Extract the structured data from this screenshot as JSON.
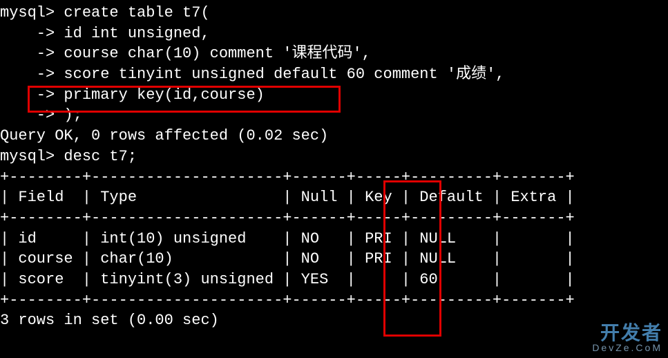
{
  "terminal": {
    "lines": [
      "mysql> create table t7(",
      "    -> id int unsigned,",
      "    -> course char(10) comment '课程代码',",
      "    -> score tinyint unsigned default 60 comment '成绩',",
      "    -> primary key(id,course)",
      "    -> );",
      "Query OK, 0 rows affected (0.02 sec)",
      "mysql> desc t7;",
      "+--------+---------------------+------+-----+---------+-------+",
      "| Field  | Type                | Null | Key | Default | Extra |",
      "+--------+---------------------+------+-----+---------+-------+",
      "| id     | int(10) unsigned    | NO   | PRI | NULL    |       |",
      "| course | char(10)            | NO   | PRI | NULL    |       |",
      "| score  | tinyint(3) unsigned | YES  |     | 60      |       |",
      "+--------+---------------------+------+-----+---------+-------+",
      "3 rows in set (0.00 sec)"
    ]
  },
  "desc_table": {
    "headers": [
      "Field",
      "Type",
      "Null",
      "Key",
      "Default",
      "Extra"
    ],
    "rows": [
      {
        "Field": "id",
        "Type": "int(10) unsigned",
        "Null": "NO",
        "Key": "PRI",
        "Default": "NULL",
        "Extra": ""
      },
      {
        "Field": "course",
        "Type": "char(10)",
        "Null": "NO",
        "Key": "PRI",
        "Default": "NULL",
        "Extra": ""
      },
      {
        "Field": "score",
        "Type": "tinyint(3) unsigned",
        "Null": "YES",
        "Key": "",
        "Default": "60",
        "Extra": ""
      }
    ]
  },
  "highlights": {
    "box1_target": "primary key(id,course)",
    "box2_target": "Key column"
  },
  "watermark": {
    "line1": "开发者",
    "line2": "DevZe.CoM"
  }
}
